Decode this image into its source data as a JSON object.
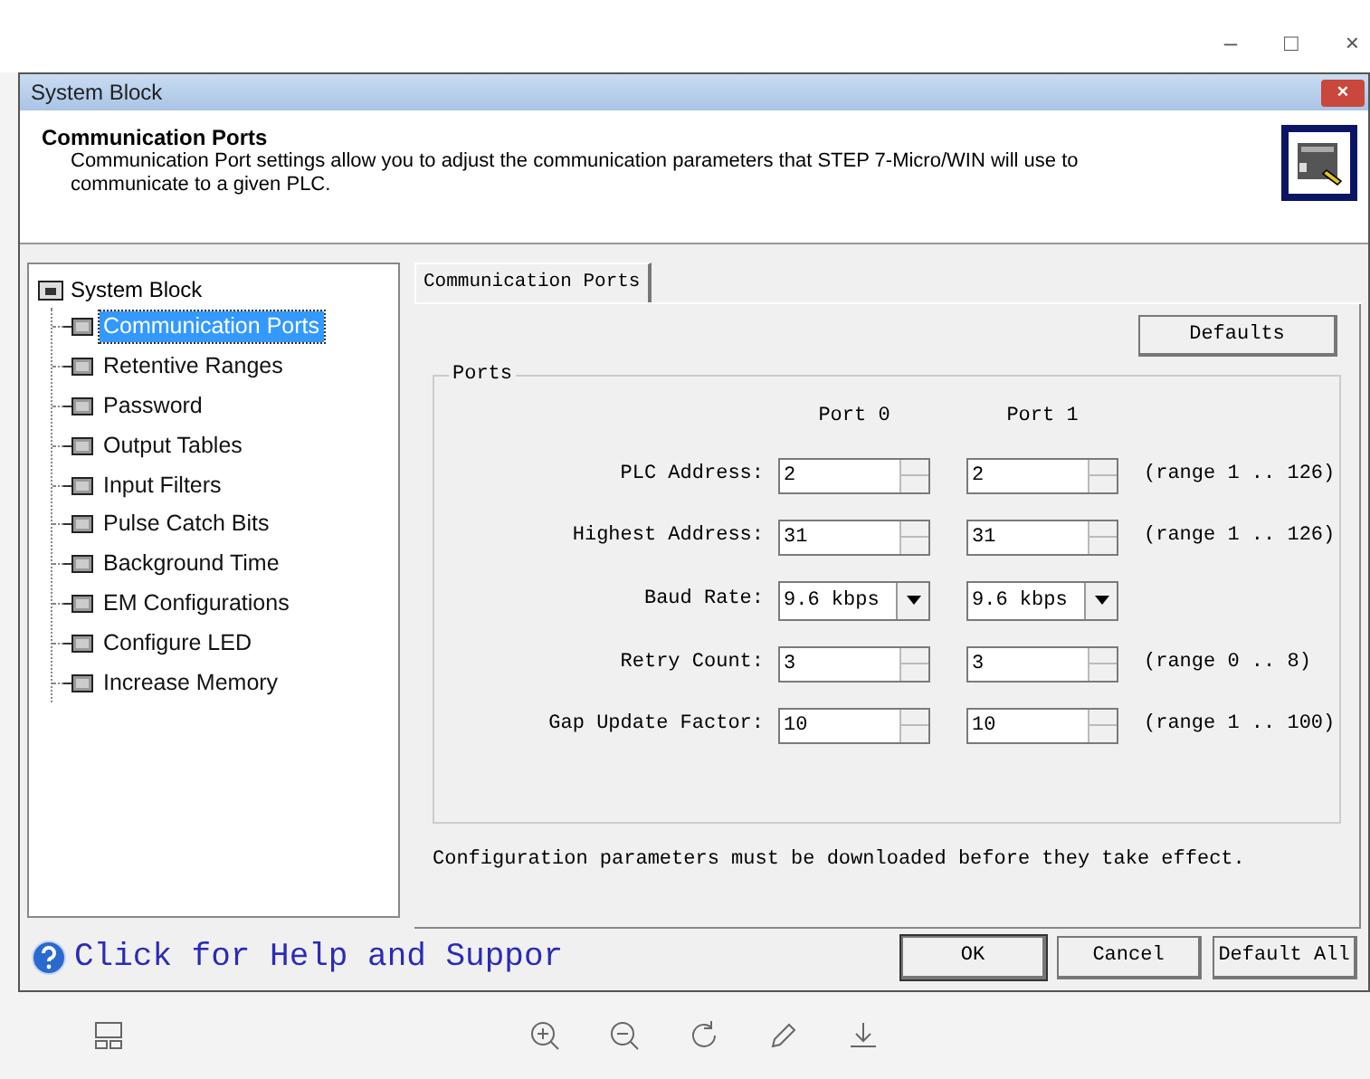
{
  "viewer_controls": [
    "–",
    "□",
    "×"
  ],
  "window": {
    "title": "System Block",
    "close": "×"
  },
  "header": {
    "title": "Communication Ports",
    "description": "Communication Port settings allow you to adjust the communication parameters that STEP 7-Micro/WIN will use to communicate to a given PLC."
  },
  "tree": {
    "label": "System Block",
    "children": [
      {
        "label": "Communication Ports",
        "selected": true
      },
      {
        "label": "Retentive Ranges",
        "selected": false
      },
      {
        "label": "Password",
        "selected": false
      },
      {
        "label": "Output Tables",
        "selected": false
      },
      {
        "label": "Input Filters",
        "selected": false
      },
      {
        "label": "Pulse Catch Bits",
        "selected": false
      },
      {
        "label": "Background Time",
        "selected": false
      },
      {
        "label": "EM Configurations",
        "selected": false
      },
      {
        "label": "Configure LED",
        "selected": false
      },
      {
        "label": "Increase Memory",
        "selected": false
      }
    ]
  },
  "tabs": [
    {
      "label": "Communication Ports",
      "selected": true
    }
  ],
  "defaults_button": "Defaults",
  "group": {
    "title": "Ports",
    "columns": [
      "Port 0",
      "Port 1"
    ],
    "rows": [
      {
        "label": "PLC Address:",
        "kind": "spin",
        "values": [
          "2",
          "2"
        ],
        "range": "(range 1 .. 126)"
      },
      {
        "label": "Highest Address:",
        "kind": "spin",
        "values": [
          "31",
          "31"
        ],
        "range": "(range 1 .. 126)"
      },
      {
        "label": "Baud Rate:",
        "kind": "dropdown",
        "values": [
          "9.6 kbps",
          "9.6 kbps"
        ]
      },
      {
        "label": "Retry Count:",
        "kind": "spin",
        "values": [
          "3",
          "3"
        ],
        "range": "(range 0 .. 8)"
      },
      {
        "label": "Gap Update Factor:",
        "kind": "spin",
        "values": [
          "10",
          "10"
        ],
        "range": "(range 1 .. 100)"
      }
    ]
  },
  "note": "Configuration parameters must be downloaded before they take effect.",
  "help_link": "Click for Help and Suppor",
  "buttons": [
    "OK",
    "Cancel",
    "Default All"
  ]
}
